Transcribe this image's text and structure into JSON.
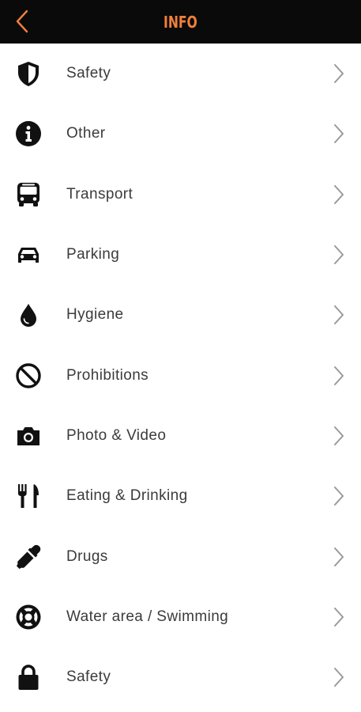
{
  "header": {
    "title": "INFO",
    "accent": "#f0803c",
    "background": "#0a0a0a"
  },
  "items": [
    {
      "label": "Safety",
      "icon": "shield-icon"
    },
    {
      "label": "Other",
      "icon": "info-icon"
    },
    {
      "label": "Transport",
      "icon": "bus-icon"
    },
    {
      "label": "Parking",
      "icon": "car-icon"
    },
    {
      "label": "Hygiene",
      "icon": "water-drop-icon"
    },
    {
      "label": "Prohibitions",
      "icon": "prohibited-icon"
    },
    {
      "label": "Photo & Video",
      "icon": "camera-icon"
    },
    {
      "label": "Eating & Drinking",
      "icon": "fork-knife-icon"
    },
    {
      "label": "Drugs",
      "icon": "dropper-icon"
    },
    {
      "label": "Water area / Swimming",
      "icon": "lifebuoy-icon"
    },
    {
      "label": "Safety",
      "icon": "lock-icon"
    }
  ]
}
